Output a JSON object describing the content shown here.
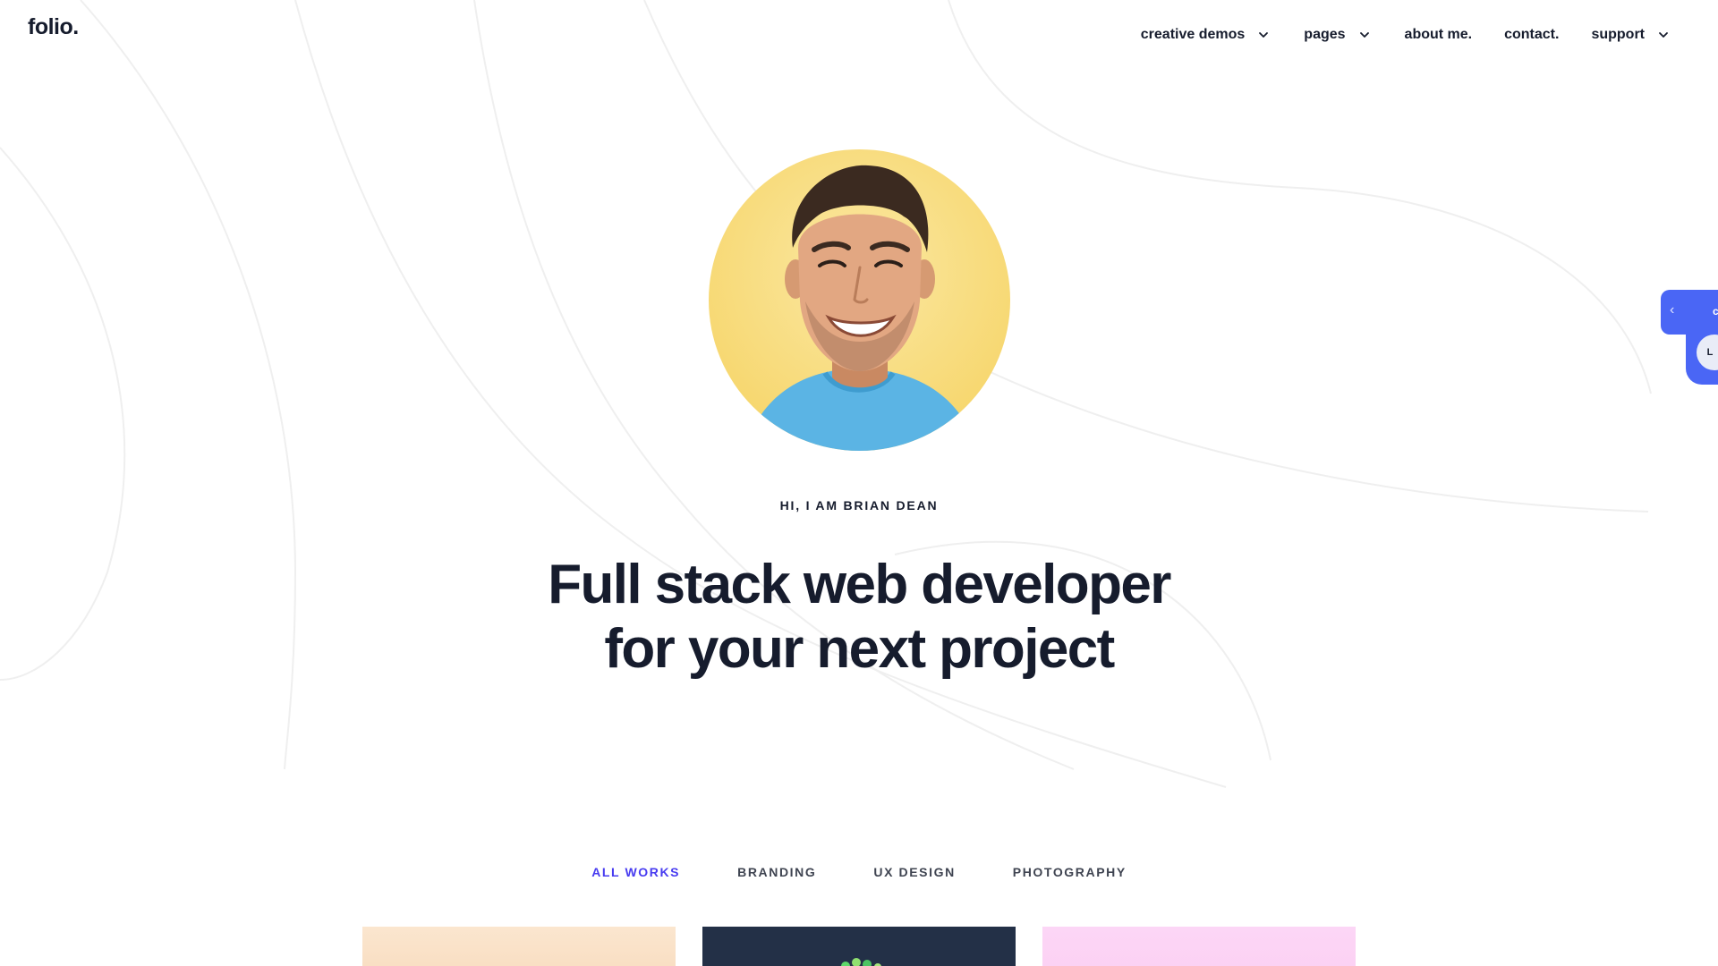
{
  "header": {
    "logo": "folio.",
    "nav": [
      {
        "label": "creative demos",
        "has_dropdown": true
      },
      {
        "label": "pages",
        "has_dropdown": true
      },
      {
        "label": "about me.",
        "has_dropdown": false
      },
      {
        "label": "contact.",
        "has_dropdown": false
      },
      {
        "label": "support",
        "has_dropdown": true
      }
    ]
  },
  "hero": {
    "eyebrow": "HI, I AM BRIAN DEAN",
    "headline_line1": "Full stack web developer",
    "headline_line2": "for your next project",
    "avatar_bg_color": "#f8dc7a"
  },
  "filters": {
    "items": [
      "ALL WORKS",
      "BRANDING",
      "UX DESIGN",
      "PHOTOGRAPHY"
    ],
    "active": "ALL WORKS",
    "active_color": "#473bf0"
  },
  "side_widget": {
    "arrow": "‹",
    "peek_text": "c",
    "circle_text": "L",
    "color": "#4a66f5"
  },
  "colors": {
    "text": "#161c2d",
    "accent": "#473bf0",
    "widget": "#4a66f5"
  }
}
